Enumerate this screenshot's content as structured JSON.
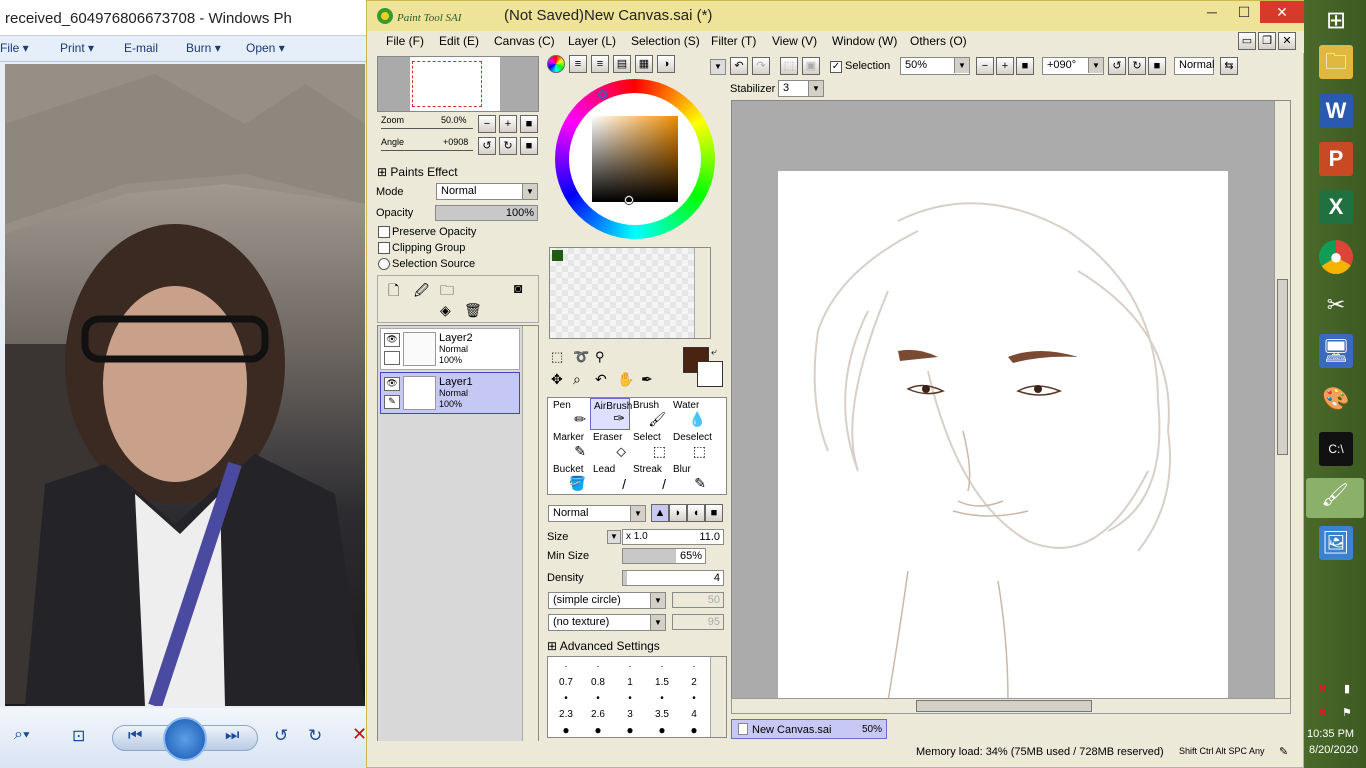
{
  "photo_viewer": {
    "title": "received_604976806673708 - Windows Ph",
    "menu": [
      "File",
      "Print",
      "E-mail",
      "Burn",
      "Open"
    ]
  },
  "sai": {
    "title": "(Not Saved)New Canvas.sai (*)",
    "logo_text": "Paint Tool SAI",
    "menu": [
      "File (F)",
      "Edit (E)",
      "Canvas (C)",
      "Layer (L)",
      "Selection (S)",
      "Filter (T)",
      "View (V)",
      "Window (W)",
      "Others (O)"
    ],
    "navigator": {
      "zoom_label": "Zoom",
      "zoom_value": "50.0%",
      "angle_label": "Angle",
      "angle_value": "+0908"
    },
    "paints_effect": "Paints Effect",
    "mode_label": "Mode",
    "mode_value": "Normal",
    "opacity_label": "Opacity",
    "opacity_value": "100%",
    "preserve_opacity": "Preserve Opacity",
    "clipping_group": "Clipping Group",
    "selection_source": "Selection Source",
    "layers": [
      {
        "name": "Layer2",
        "mode": "Normal",
        "opacity": "100%"
      },
      {
        "name": "Layer1",
        "mode": "Normal",
        "opacity": "100%"
      }
    ],
    "tools": [
      "Pen",
      "AirBrush",
      "Brush",
      "Water",
      "Marker",
      "Eraser",
      "Select",
      "Deselect",
      "Bucket",
      "Lead",
      "Streak",
      "Blur"
    ],
    "brush_mode": "Normal",
    "size_label": "Size",
    "size_mult": "x 1.0",
    "size_value": "11.0",
    "min_size_label": "Min Size",
    "min_size_value": "65%",
    "density_label": "Density",
    "density_value": "4",
    "shape": "(simple circle)",
    "shape_val": "50",
    "texture": "(no texture)",
    "texture_val": "95",
    "advanced": "Advanced Settings",
    "brush_sizes": [
      "0.7",
      "0.8",
      "1",
      "1.5",
      "2",
      "2.3",
      "2.6",
      "3",
      "3.5",
      "4"
    ],
    "toolbar": {
      "selection": "Selection",
      "zoom": "50%",
      "angle": "+090°",
      "blend": "Normal",
      "stabilizer_label": "Stabilizer",
      "stabilizer_value": "3"
    },
    "doc_tab": "New Canvas.sai",
    "doc_tab_zoom": "50%",
    "status": "Memory load: 34% (75MB used / 728MB reserved)",
    "status_keys": "Shift Ctrl Alt SPC Any",
    "fg_color": "#4a2410",
    "swatch_color": "#1f5c0f"
  },
  "taskbar": {
    "time": "10:35 PM",
    "date": "8/20/2020"
  }
}
